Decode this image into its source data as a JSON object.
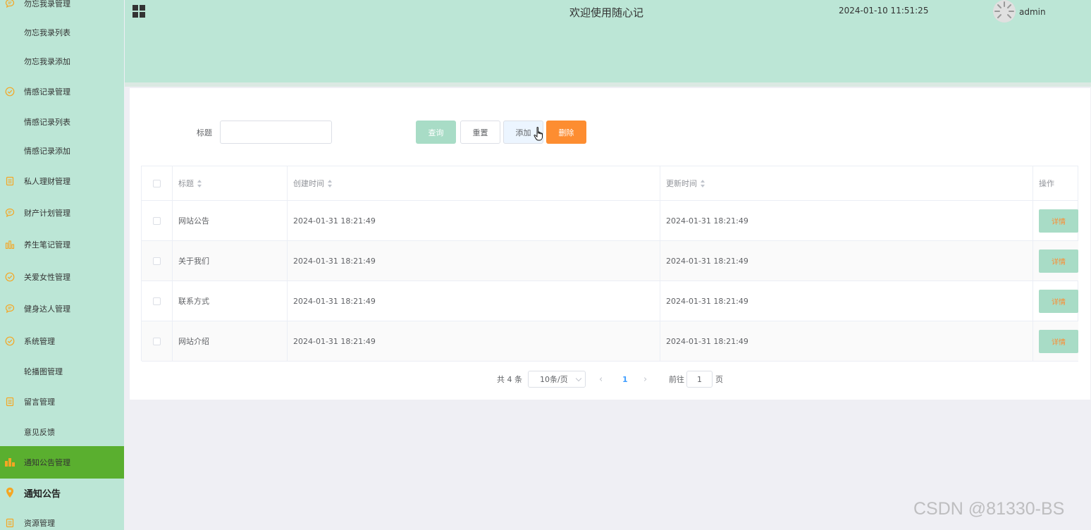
{
  "sidebar": {
    "items": [
      {
        "label": "勿忘我录管理",
        "icon": "chat-bubble-icon"
      },
      {
        "label": "勿忘我录列表",
        "icon": ""
      },
      {
        "label": "勿忘我录添加",
        "icon": ""
      },
      {
        "label": "情感记录管理",
        "icon": "check-circle-icon"
      },
      {
        "label": "情感记录列表",
        "icon": ""
      },
      {
        "label": "情感记录添加",
        "icon": ""
      },
      {
        "label": "私人理财管理",
        "icon": "document-icon"
      },
      {
        "label": "财产计划管理",
        "icon": "chat-bubble-icon"
      },
      {
        "label": "养生笔记管理",
        "icon": "bar-chart-icon"
      },
      {
        "label": "关爱女性管理",
        "icon": "check-circle-icon"
      },
      {
        "label": "健身达人管理",
        "icon": "chat-bubble-icon"
      },
      {
        "label": "系统管理",
        "icon": "check-circle-icon"
      },
      {
        "label": "轮播图管理",
        "icon": ""
      },
      {
        "label": "留言管理",
        "icon": "document-icon"
      },
      {
        "label": "意见反馈",
        "icon": ""
      },
      {
        "label": "通知公告管理",
        "icon": "bar-chart-icon"
      },
      {
        "label": "通知公告",
        "icon": "location-pin-icon"
      },
      {
        "label": "资源管理",
        "icon": "document-icon"
      }
    ],
    "active_index": 15
  },
  "header": {
    "title": "欢迎使用随心记",
    "datetime": "2024-01-10 11:51:25",
    "username": "admin"
  },
  "search": {
    "label": "标题",
    "value": "",
    "placeholder": ""
  },
  "buttons": {
    "search": "查询",
    "reset": "重置",
    "add": "添加",
    "delete": "删除"
  },
  "table": {
    "columns": {
      "title": "标题",
      "created": "创建时间",
      "updated": "更新时间",
      "operation": "操作"
    },
    "rows": [
      {
        "title": "网站公告",
        "created": "2024-01-31 18:21:49",
        "updated": "2024-01-31 18:21:49",
        "action": "详情"
      },
      {
        "title": "关于我们",
        "created": "2024-01-31 18:21:49",
        "updated": "2024-01-31 18:21:49",
        "action": "详情"
      },
      {
        "title": "联系方式",
        "created": "2024-01-31 18:21:49",
        "updated": "2024-01-31 18:21:49",
        "action": "详情"
      },
      {
        "title": "网站介绍",
        "created": "2024-01-31 18:21:49",
        "updated": "2024-01-31 18:21:49",
        "action": "详情"
      }
    ]
  },
  "pagination": {
    "total": "共 4 条",
    "page_size": "10条/页",
    "current_page": "1",
    "goto_label": "前往",
    "goto_value": "1",
    "page_suffix": "页"
  },
  "watermark": "CSDN @81330-BS",
  "colors": {
    "sidebar_bg": "#bce6d6",
    "active_item": "#5aaf2f",
    "icon_orange": "#f5a623",
    "delete_button": "#fd8d31",
    "search_button": "#a8dcc6"
  }
}
